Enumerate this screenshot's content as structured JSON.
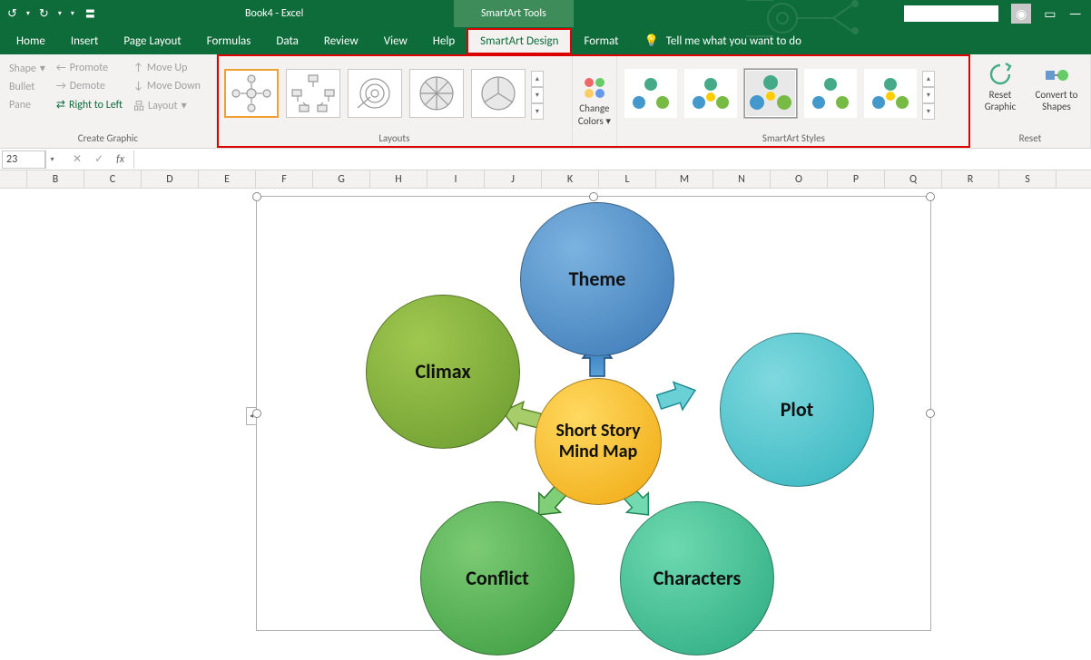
{
  "app": {
    "title": "Book4 - Excel",
    "context_tab": "SmartArt Tools"
  },
  "tabs": {
    "home": "Home",
    "insert": "Insert",
    "page": "Page Layout",
    "formulas": "Formulas",
    "data": "Data",
    "review": "Review",
    "view": "View",
    "help": "Help",
    "sad": "SmartArt Design",
    "format": "Format",
    "tellme": "Tell me what you want to do"
  },
  "ribbon": {
    "create": {
      "shape": "Shape",
      "bullet": "Bullet",
      "pane": "Pane",
      "promote": "Promote",
      "demote": "Demote",
      "rtl": "Right to Left",
      "moveup": "Move Up",
      "movedown": "Move Down",
      "layout": "Layout",
      "label": "Create Graphic"
    },
    "layouts": {
      "label": "Layouts"
    },
    "colors": {
      "change": "Change",
      "colors": "Colors"
    },
    "styles": {
      "label": "SmartArt Styles"
    },
    "reset": {
      "reset_graphic": "Reset Graphic",
      "convert": "Convert to Shapes",
      "label": "Reset"
    }
  },
  "namebox": "23",
  "cols": [
    "B",
    "C",
    "D",
    "E",
    "F",
    "G",
    "H",
    "I",
    "J",
    "K",
    "L",
    "M",
    "N",
    "O",
    "P",
    "Q",
    "R",
    "S"
  ],
  "smartart": {
    "center": "Short Story Mind Map",
    "theme": "Theme",
    "plot": "Plot",
    "characters": "Characters",
    "conflict": "Conflict",
    "climax": "Climax"
  }
}
